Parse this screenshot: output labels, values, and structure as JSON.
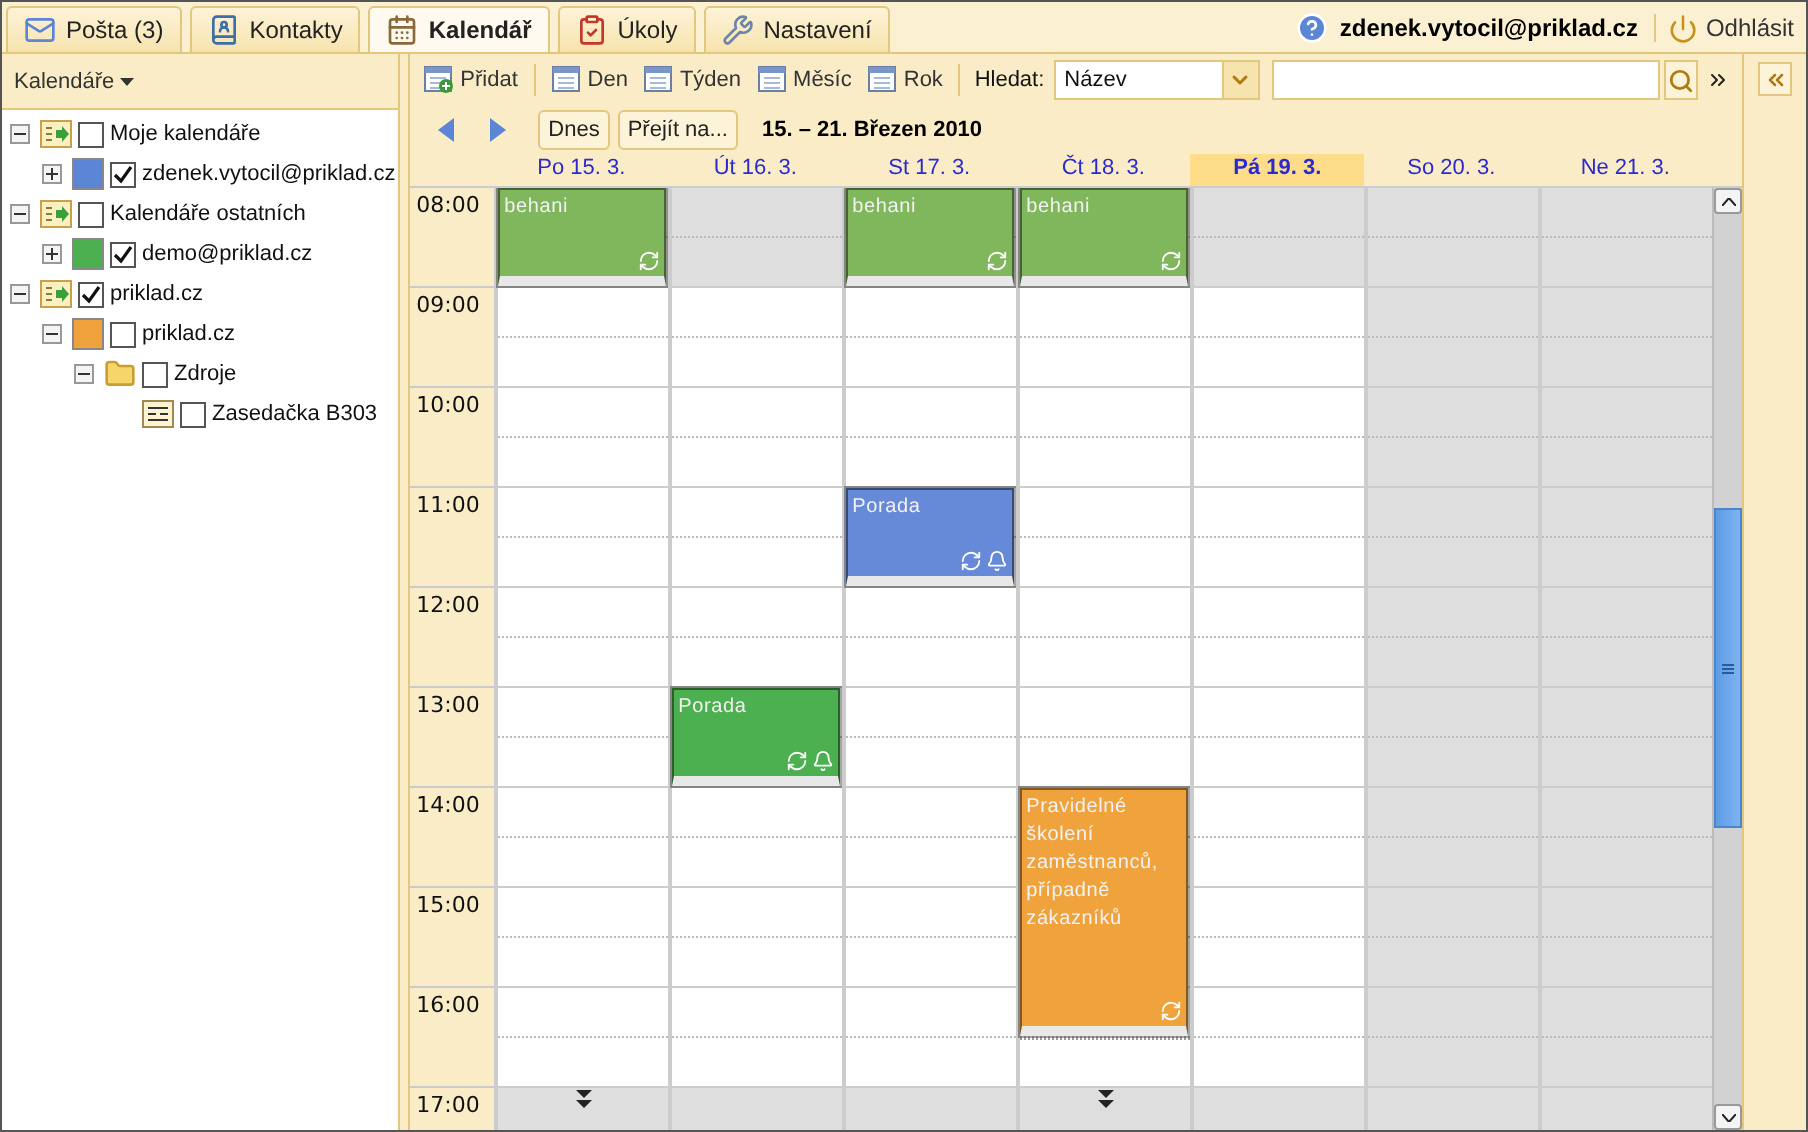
{
  "tabs": [
    {
      "label": "Pošta (3)",
      "kind": "mail",
      "selected": false
    },
    {
      "label": "Kontakty",
      "kind": "contacts",
      "selected": false
    },
    {
      "label": "Kalendář",
      "kind": "calendar",
      "selected": true
    },
    {
      "label": "Úkoly",
      "kind": "tasks",
      "selected": false
    },
    {
      "label": "Nastavení",
      "kind": "settings",
      "selected": false
    }
  ],
  "user": {
    "email": "zdenek.vytocil@priklad.cz",
    "logout": "Odhlásit"
  },
  "sidebar": {
    "title": "Kalendáře",
    "tree": [
      {
        "label": "Moje kalendáře",
        "kind": "group",
        "expanded": true,
        "checked": false,
        "children": [
          {
            "label": "zdenek.vytocil@priklad.cz",
            "kind": "calendar",
            "expanded": false,
            "checked": true,
            "color": "#5b86d6"
          }
        ]
      },
      {
        "label": "Kalendáře ostatních",
        "kind": "group",
        "expanded": true,
        "checked": false,
        "children": [
          {
            "label": "demo@priklad.cz",
            "kind": "calendar",
            "expanded": false,
            "checked": true,
            "color": "#4caf50"
          }
        ]
      },
      {
        "label": "priklad.cz",
        "kind": "group",
        "expanded": true,
        "checked": true,
        "children": [
          {
            "label": "priklad.cz",
            "kind": "calendar",
            "expanded": true,
            "checked": false,
            "color": "#f0a33c",
            "children": [
              {
                "label": "Zdroje",
                "kind": "folder",
                "expanded": true,
                "checked": false,
                "children": [
                  {
                    "label": "Zasedačka B303",
                    "kind": "resource",
                    "checked": false
                  }
                ]
              }
            ]
          }
        ]
      }
    ]
  },
  "toolbar": {
    "buttons": [
      {
        "label": "Přidat",
        "kind": "add"
      },
      {
        "label": "Den",
        "kind": "day"
      },
      {
        "label": "Týden",
        "kind": "week"
      },
      {
        "label": "Měsíc",
        "kind": "month"
      },
      {
        "label": "Rok",
        "kind": "year"
      }
    ],
    "search_label": "Hledat:",
    "search_field": {
      "value": "Název"
    }
  },
  "navigation": {
    "today": "Dnes",
    "goto": "Přejít na...",
    "range": "15. – 21. Březen 2010"
  },
  "calendar": {
    "hours": [
      "08:00",
      "09:00",
      "10:00",
      "11:00",
      "12:00",
      "13:00",
      "14:00",
      "15:00",
      "16:00",
      "17:00"
    ],
    "days": [
      {
        "label": "Po 15. 3.",
        "today": false,
        "more_below": true,
        "cells": [
          {
            "shaded": true,
            "event": {
              "title": "behani",
              "kind": "short",
              "color": "#80b65c",
              "recurring": true,
              "reminder": false
            }
          },
          {
            "shaded": false
          },
          {
            "shaded": false
          },
          {
            "shaded": false
          },
          {
            "shaded": false
          },
          {
            "shaded": false
          },
          {
            "shaded": false
          },
          {
            "shaded": false
          },
          {
            "shaded": false
          },
          {
            "shaded": true
          }
        ]
      },
      {
        "label": "Út 16. 3.",
        "today": false,
        "more_below": false,
        "cells": [
          {
            "shaded": true
          },
          {
            "shaded": false
          },
          {
            "shaded": false
          },
          {
            "shaded": false
          },
          {
            "shaded": false
          },
          {
            "shaded": false,
            "event": {
              "title": "Porada",
              "kind": "short",
              "color": "#4caf50",
              "recurring": true,
              "reminder": true
            }
          },
          {
            "shaded": false
          },
          {
            "shaded": false
          },
          {
            "shaded": false
          },
          {
            "shaded": true
          }
        ]
      },
      {
        "label": "St 17. 3.",
        "today": false,
        "more_below": false,
        "cells": [
          {
            "shaded": true,
            "event": {
              "title": "behani",
              "kind": "short",
              "color": "#80b65c",
              "recurring": true,
              "reminder": false
            }
          },
          {
            "shaded": false
          },
          {
            "shaded": false
          },
          {
            "shaded": false,
            "event": {
              "title": "Porada",
              "kind": "short",
              "color": "#6689d8",
              "recurring": true,
              "reminder": true
            }
          },
          {
            "shaded": false
          },
          {
            "shaded": false
          },
          {
            "shaded": false
          },
          {
            "shaded": false
          },
          {
            "shaded": false
          },
          {
            "shaded": true
          }
        ]
      },
      {
        "label": "Čt 18. 3.",
        "today": false,
        "more_below": true,
        "cells": [
          {
            "shaded": true,
            "event": {
              "title": "behani",
              "kind": "short",
              "color": "#80b65c",
              "recurring": true,
              "reminder": false
            }
          },
          {
            "shaded": false
          },
          {
            "shaded": false
          },
          {
            "shaded": false
          },
          {
            "shaded": false
          },
          {
            "shaded": false
          },
          {
            "shaded": false,
            "event": {
              "title": "Pravidelné školení zaměstnanců, případně zákazníků",
              "kind": "long",
              "color": "#f0a33c",
              "recurring": true,
              "reminder": false
            }
          },
          {
            "shaded": false
          },
          {
            "shaded": false
          },
          {
            "shaded": true
          }
        ]
      },
      {
        "label": "Pá 19. 3.",
        "today": true,
        "more_below": false,
        "cells": [
          {
            "shaded": true
          },
          {
            "shaded": false
          },
          {
            "shaded": false
          },
          {
            "shaded": false
          },
          {
            "shaded": false
          },
          {
            "shaded": false
          },
          {
            "shaded": false
          },
          {
            "shaded": false
          },
          {
            "shaded": false
          },
          {
            "shaded": true
          }
        ]
      },
      {
        "label": "So 20. 3.",
        "today": false,
        "more_below": false,
        "cells": [
          {
            "shaded": true
          },
          {
            "shaded": true
          },
          {
            "shaded": true
          },
          {
            "shaded": true
          },
          {
            "shaded": true
          },
          {
            "shaded": true
          },
          {
            "shaded": true
          },
          {
            "shaded": true
          },
          {
            "shaded": true
          },
          {
            "shaded": true
          }
        ]
      },
      {
        "label": "Ne 21. 3.",
        "today": false,
        "more_below": false,
        "cells": [
          {
            "shaded": true
          },
          {
            "shaded": true
          },
          {
            "shaded": true
          },
          {
            "shaded": true
          },
          {
            "shaded": true
          },
          {
            "shaded": true
          },
          {
            "shaded": true
          },
          {
            "shaded": true
          },
          {
            "shaded": true
          },
          {
            "shaded": true
          }
        ]
      }
    ]
  }
}
